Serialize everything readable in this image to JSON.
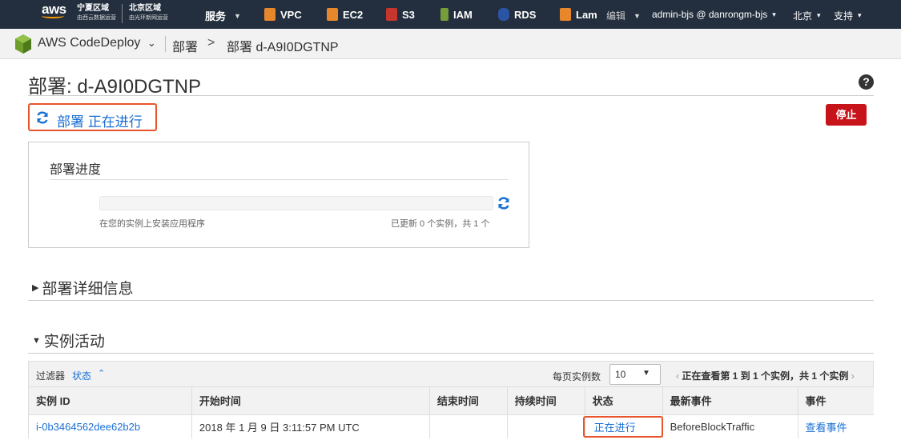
{
  "nav": {
    "logo_text": "aws",
    "region1_name": "宁夏区域",
    "region1_sub": "由西云数据运营",
    "region2_name": "北京区域",
    "region2_sub": "由光环新网运营",
    "services": "服务",
    "items": [
      {
        "label": "VPC",
        "icon": "vpc-icon",
        "color": "#e7872c"
      },
      {
        "label": "EC2",
        "icon": "ec2-icon",
        "color": "#e7872c"
      },
      {
        "label": "S3",
        "icon": "s3-icon",
        "color": "#c7362c"
      },
      {
        "label": "IAM",
        "icon": "iam-icon",
        "color": "#779c3a"
      },
      {
        "label": "RDS",
        "icon": "rds-icon",
        "color": "#2a55a5"
      },
      {
        "label": "Lam",
        "icon": "lambda-icon",
        "color": "#e7872c"
      }
    ],
    "edit": "编辑",
    "account": "admin-bjs @ danrongm-bjs",
    "region": "北京",
    "support": "支持"
  },
  "breadcrumb": {
    "service": "AWS CodeDeploy",
    "deployments": "部署",
    "separator": ">",
    "current": "部署 d-A9I0DGTNP"
  },
  "page": {
    "title": "部署: d-A9I0DGTNP",
    "status": "部署 正在进行",
    "stop_button": "停止"
  },
  "progress": {
    "title": "部署进度",
    "fraction": 0,
    "left_caption": "在您的实例上安装应用程序",
    "right_caption": "已更新 0 个实例，共 1 个"
  },
  "sections": {
    "details": "部署详细信息",
    "activity": "实例活动"
  },
  "table": {
    "filter_label": "过滤器",
    "filter_value": "状态",
    "per_page_label": "每页实例数",
    "per_page_value": "10",
    "paging": "正在查看第 1 到 1 个实例，共 1 个实例",
    "columns": [
      "实例 ID",
      "开始时间",
      "结束时间",
      "持续时间",
      "状态",
      "最新事件",
      "事件"
    ],
    "rows": [
      {
        "instance_id": "i-0b3464562dee62b2b",
        "start_time": "2018 年 1 月 9 日 3:11:57 PM UTC",
        "end_time": "",
        "duration": "",
        "status": "正在进行",
        "latest_event": "BeforeBlockTraffic",
        "events_link": "查看事件"
      }
    ]
  },
  "colors": {
    "nav_bg": "#232f3e",
    "link": "#1a6fd4",
    "highlight": "#e8542c",
    "stop": "#c7131a"
  }
}
